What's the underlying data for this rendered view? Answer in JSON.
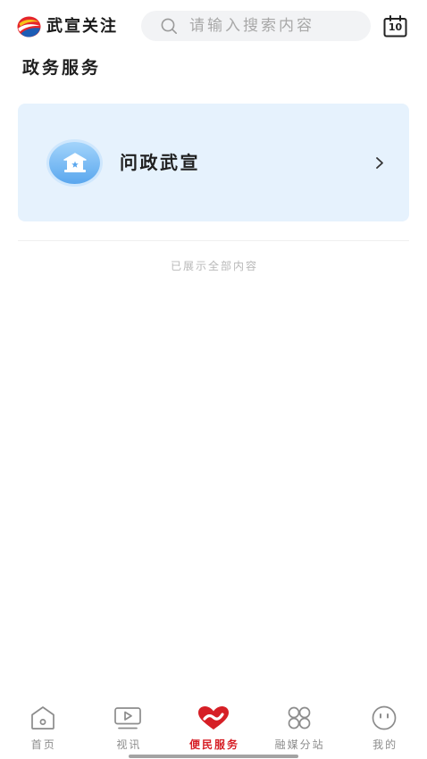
{
  "header": {
    "logo_icon": "app-logo-icon",
    "app_name": "武宣关注",
    "search_icon": "search-icon",
    "search_placeholder": "请输入搜索内容",
    "calendar_icon": "calendar-icon",
    "calendar_day": "10"
  },
  "section": {
    "title": "政务服务"
  },
  "services": [
    {
      "label": "问政武宣",
      "icon": "government-building-icon",
      "trailing_icon": "chevron-right-icon"
    }
  ],
  "end_notice": "已展示全部内容",
  "tabbar": {
    "items": [
      {
        "label": "首页",
        "icon": "home-icon",
        "active": false
      },
      {
        "label": "视讯",
        "icon": "video-play-icon",
        "active": false
      },
      {
        "label": "便民服务",
        "icon": "heart-service-icon",
        "active": true
      },
      {
        "label": "融媒分站",
        "icon": "clover-grid-icon",
        "active": false
      },
      {
        "label": "我的",
        "icon": "face-icon",
        "active": false
      }
    ]
  },
  "colors": {
    "accent": "#d61f26",
    "card_background": "#e6f2fd",
    "tab_inactive": "#8c8c8c",
    "text_primary": "#1f1f1f",
    "placeholder": "#a8a8a8"
  }
}
